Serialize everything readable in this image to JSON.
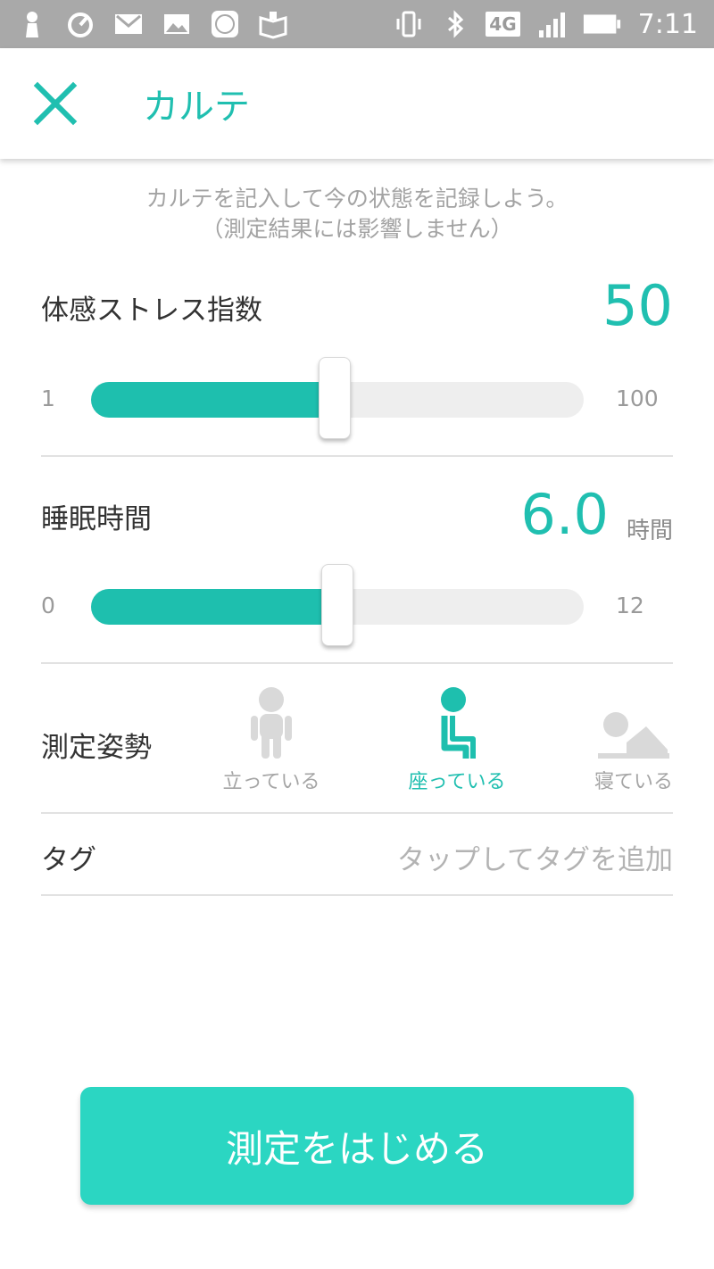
{
  "status_bar": {
    "network": "4G",
    "time": "7:11",
    "icons": [
      "person-icon",
      "speedometer-icon",
      "gmail-icon",
      "image-icon",
      "mi-icon",
      "amazon-kindle-icon",
      "vibrate-icon",
      "bluetooth-icon",
      "signal-icon",
      "battery-icon"
    ]
  },
  "app_bar": {
    "title": "カルテ",
    "close_icon": "close-icon"
  },
  "intro": {
    "line1": "カルテを記入して今の状態を記録しよう。",
    "line2": "（測定結果には影響しません）"
  },
  "stress": {
    "label": "体感ストレス指数",
    "value": "50",
    "min_label": "1",
    "max_label": "100",
    "fraction": 0.495
  },
  "sleep": {
    "label": "睡眠時間",
    "value": "6.0",
    "unit": "時間",
    "min_label": "0",
    "max_label": "12",
    "fraction": 0.5
  },
  "posture": {
    "label": "測定姿勢",
    "options": [
      {
        "label": "立っている",
        "icon": "standing-person-icon",
        "selected": false
      },
      {
        "label": "座っている",
        "icon": "sitting-person-icon",
        "selected": true
      },
      {
        "label": "寝ている",
        "icon": "lying-person-icon",
        "selected": false
      }
    ]
  },
  "tag": {
    "label": "タグ",
    "placeholder": "タップしてタグを追加"
  },
  "start_button": {
    "label": "測定をはじめる"
  },
  "colors": {
    "accent": "#20bfb0",
    "button": "#2bd6c2",
    "status_bar": "#a9a9a9",
    "track": "#eeeeee"
  }
}
